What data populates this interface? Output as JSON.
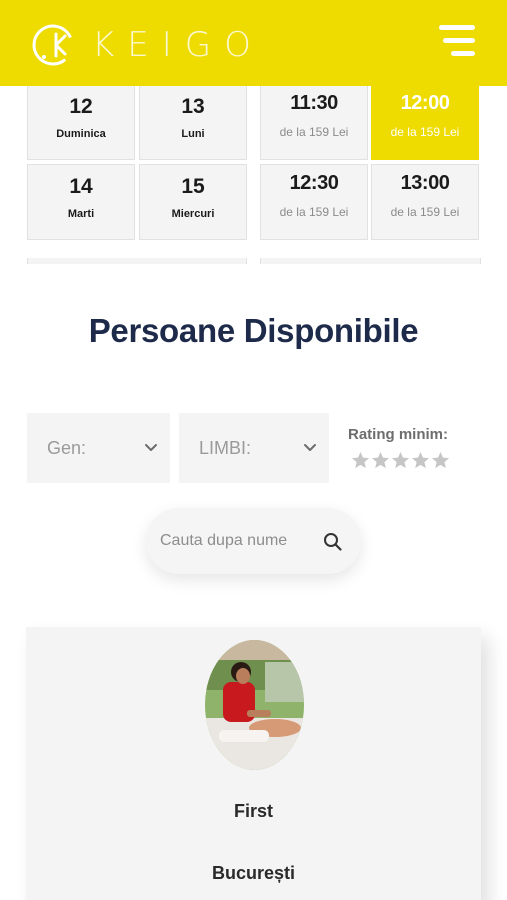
{
  "header": {
    "brand": "KEIGO",
    "brand_color": "#eedb00",
    "menu_icon": "hamburger-icon"
  },
  "calendar": {
    "days": [
      {
        "num": "12",
        "name": "Duminica"
      },
      {
        "num": "13",
        "name": "Luni"
      },
      {
        "num": "14",
        "name": "Marti"
      },
      {
        "num": "15",
        "name": "Miercuri"
      }
    ],
    "slots": [
      {
        "time": "11:30",
        "price": "de la 159 Lei",
        "selected": false
      },
      {
        "time": "12:00",
        "price": "de la 159 Lei",
        "selected": true
      },
      {
        "time": "12:30",
        "price": "de la 159 Lei",
        "selected": false
      },
      {
        "time": "13:00",
        "price": "de la 159 Lei",
        "selected": false
      }
    ]
  },
  "section": {
    "title": "Persoane Disponibile"
  },
  "filters": {
    "gender_label": "Gen:",
    "languages_label": "LIMBI:",
    "rating_label": "Rating minim:",
    "rating_value": 0,
    "rating_max": 5
  },
  "search": {
    "placeholder": "Cauta dupa nume",
    "icon": "search-icon"
  },
  "person": {
    "name": "First",
    "city": "București",
    "photo_icon": "massage-photo"
  }
}
